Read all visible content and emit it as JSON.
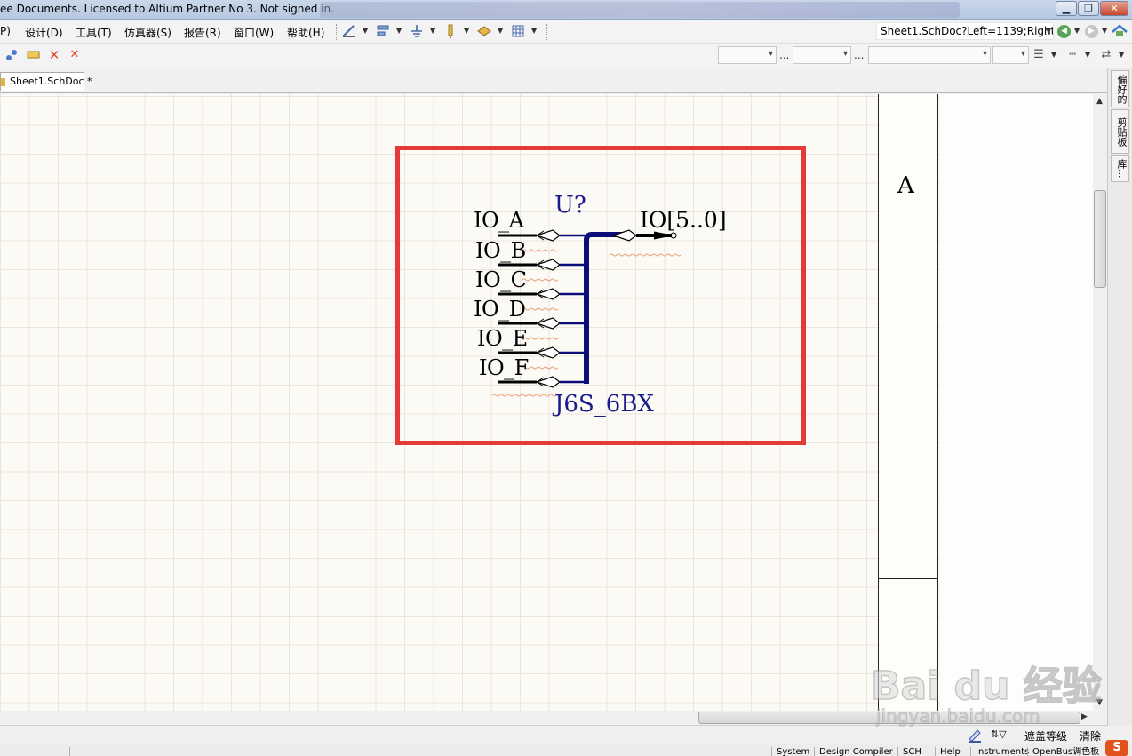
{
  "window": {
    "title": "ee Documents. Licensed to Altium Partner No 3. Not signed in.",
    "minimize": "▁",
    "restore": "❐",
    "close": "✕"
  },
  "menu": {
    "items": [
      "P)",
      "设计(D)",
      "工具(T)",
      "仿真器(S)",
      "报告(R)",
      "窗口(W)",
      "帮助(H)"
    ]
  },
  "address": {
    "value": "Sheet1.SchDoc?Left=1139;Right"
  },
  "tabs": {
    "doc": "Sheet1.SchDoc *"
  },
  "side_panel": {
    "tabs": [
      "偏好的",
      "剪贴板",
      "库..."
    ]
  },
  "sheet": {
    "zone_label": "A"
  },
  "schematic": {
    "pins": [
      "IO_A",
      "IO_B",
      "IO_C",
      "IO_D",
      "IO_E",
      "IO_F"
    ],
    "designator": "U?",
    "comment": "J6S_6BX",
    "bus_net": "IO[5..0]"
  },
  "status": {
    "mask_level": "遮盖等级",
    "clear": "清除",
    "bottom_tabs": [
      "System",
      "Design Compiler",
      "SCH",
      "Help",
      "Instruments",
      "OpenBus调色板"
    ]
  },
  "watermark": {
    "brand": "Bai du 经验",
    "url": "jingyan.baidu.com",
    "logo": "S"
  }
}
